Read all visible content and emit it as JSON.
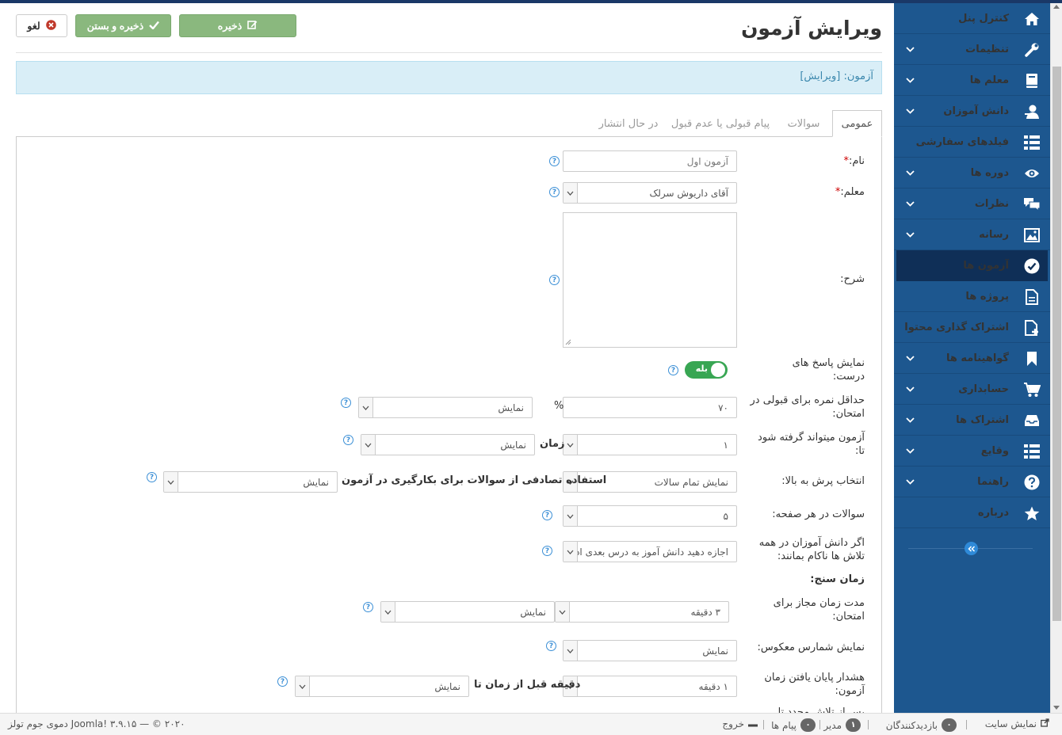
{
  "page": {
    "title": "ویرایش آزمون",
    "info": "آزمون: [ویرایش]"
  },
  "toolbar": {
    "save_label": "ذخیره",
    "save_close_label": "ذخیره و بستن",
    "cancel_label": "لغو"
  },
  "tabs": [
    {
      "label": "عمومی",
      "active": true
    },
    {
      "label": "سوالات"
    },
    {
      "label": "پیام قبولی یا عدم قبول"
    },
    {
      "label": "در حال انتشار"
    }
  ],
  "form": {
    "name_label": "نام:",
    "name_placeholder": "آزمون اول",
    "teacher_label": "معلم:",
    "teacher_value": "آقای داریوش سرلک",
    "desc_label": "شرح:",
    "show_answers_label": "نمایش پاسخ های درست:",
    "show_answers_toggle": "بله",
    "min_score_label": "حداقل نمره برای قبولی در امتحان:",
    "min_score_value": "۷۰",
    "percent": "%",
    "min_score_display": "نمایش",
    "attempts_label": "آزمون میتواند گرفته شود تا:",
    "attempts_value": "۱",
    "attempts_unit": "زمان",
    "attempts_display": "نمایش",
    "pick_label": "انتخاب پرش به بالا:",
    "pick_value": "نمایش تمام سالات",
    "random_label": "استفاده تصادفی از سوالات برای بکارگیری در آزمون",
    "random_display": "نمایش",
    "per_page_label": "سوالات در هر صفحه:",
    "per_page_value": "۵",
    "fail_label": "اگر دانش آموزان در همه تلاش ها ناکام بمانند:",
    "fail_value": "اجازه دهید دانش آموز به درس بعدی ادامه دهد",
    "timing_heading": "زمان سنج:",
    "duration_label": "مدت زمان مجاز برای امتحان:",
    "duration_value": "۳ دقیقه",
    "duration_display": "نمایش",
    "countdown_label": "نمایش شمارس معکوس:",
    "countdown_value": "نمایش",
    "warning_label": "هشدار پایان یافتن زمان آزمون:",
    "warning_value": "۱ دقیقه",
    "warning_unit": "دقیقه قبل از زمان تا",
    "warning_display": "نمایش",
    "cut_label": "پس از تلاش مجدد تا"
  },
  "sidebar": {
    "items": [
      {
        "label": "کنترل پنل",
        "icon": "home-icon",
        "chevron": false
      },
      {
        "label": "تنظیمات",
        "icon": "wrench-icon",
        "chevron": true
      },
      {
        "label": "معلم ها",
        "icon": "book-icon",
        "chevron": true
      },
      {
        "label": "دانش آموزان",
        "icon": "user-icon",
        "chevron": true
      },
      {
        "label": "فیلدهای سفارشی",
        "icon": "list-icon",
        "chevron": false
      },
      {
        "label": "دوره ها",
        "icon": "eye-icon",
        "chevron": true
      },
      {
        "label": "نظرات",
        "icon": "comments-icon",
        "chevron": true
      },
      {
        "label": "رسانه",
        "icon": "image-icon",
        "chevron": true
      },
      {
        "label": "آزمون ها",
        "icon": "check-circle-icon",
        "chevron": false,
        "active": true
      },
      {
        "label": "پروژه ها",
        "icon": "document-icon",
        "chevron": false
      },
      {
        "label": "اشتراک گذاری محتوا",
        "icon": "file-plus-icon",
        "chevron": false
      },
      {
        "label": "گواهینامه ها",
        "icon": "bookmark-icon",
        "chevron": true
      },
      {
        "label": "حسابداری",
        "icon": "cart-icon",
        "chevron": true
      },
      {
        "label": "اشتراک ها",
        "icon": "inbox-icon",
        "chevron": true
      },
      {
        "label": "وقایع",
        "icon": "list-icon",
        "chevron": true
      },
      {
        "label": "راهنما",
        "icon": "question-icon",
        "chevron": true
      },
      {
        "label": "درباره",
        "icon": "star-icon",
        "chevron": false
      }
    ]
  },
  "statusbar": {
    "view_site": "نمایش سایت",
    "visitors_count": "۰",
    "visitors_label": "بازدیدکنندگان",
    "admins_count": "۱",
    "admins_label": "مدیر",
    "messages_count": "۰",
    "messages_label": "پیام ها",
    "logout": "خروج",
    "copyright": "Joomla! ۳.۹.۱۵ — © ۲۰۲۰ دموی جوم تولز"
  },
  "colors": {
    "sidebar_bg": "#1d578f",
    "sidebar_active": "#0f2f57",
    "save_button": "#8ab87e",
    "info_bg": "#d9eef7",
    "toggle_on": "#38a653"
  }
}
